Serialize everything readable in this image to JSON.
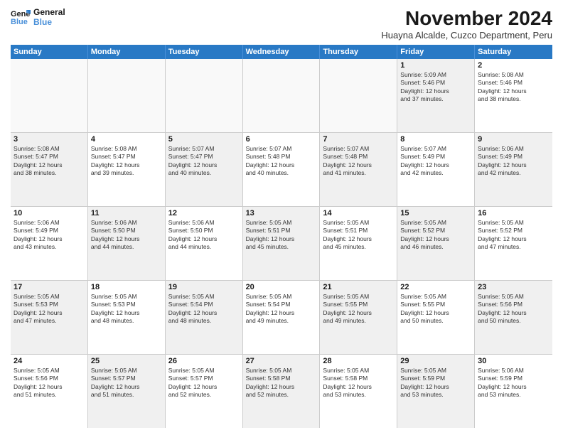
{
  "logo": {
    "line1": "General",
    "line2": "Blue"
  },
  "title": "November 2024",
  "location": "Huayna Alcalde, Cuzco Department, Peru",
  "days_of_week": [
    "Sunday",
    "Monday",
    "Tuesday",
    "Wednesday",
    "Thursday",
    "Friday",
    "Saturday"
  ],
  "weeks": [
    {
      "cells": [
        {
          "day": "",
          "info": "",
          "empty": true
        },
        {
          "day": "",
          "info": "",
          "empty": true
        },
        {
          "day": "",
          "info": "",
          "empty": true
        },
        {
          "day": "",
          "info": "",
          "empty": true
        },
        {
          "day": "",
          "info": "",
          "empty": true
        },
        {
          "day": "1",
          "info": "Sunrise: 5:09 AM\nSunset: 5:46 PM\nDaylight: 12 hours\nand 37 minutes.",
          "shaded": true
        },
        {
          "day": "2",
          "info": "Sunrise: 5:08 AM\nSunset: 5:46 PM\nDaylight: 12 hours\nand 38 minutes.",
          "shaded": false
        }
      ]
    },
    {
      "cells": [
        {
          "day": "3",
          "info": "Sunrise: 5:08 AM\nSunset: 5:47 PM\nDaylight: 12 hours\nand 38 minutes.",
          "shaded": true
        },
        {
          "day": "4",
          "info": "Sunrise: 5:08 AM\nSunset: 5:47 PM\nDaylight: 12 hours\nand 39 minutes.",
          "shaded": false
        },
        {
          "day": "5",
          "info": "Sunrise: 5:07 AM\nSunset: 5:47 PM\nDaylight: 12 hours\nand 40 minutes.",
          "shaded": true
        },
        {
          "day": "6",
          "info": "Sunrise: 5:07 AM\nSunset: 5:48 PM\nDaylight: 12 hours\nand 40 minutes.",
          "shaded": false
        },
        {
          "day": "7",
          "info": "Sunrise: 5:07 AM\nSunset: 5:48 PM\nDaylight: 12 hours\nand 41 minutes.",
          "shaded": true
        },
        {
          "day": "8",
          "info": "Sunrise: 5:07 AM\nSunset: 5:49 PM\nDaylight: 12 hours\nand 42 minutes.",
          "shaded": false
        },
        {
          "day": "9",
          "info": "Sunrise: 5:06 AM\nSunset: 5:49 PM\nDaylight: 12 hours\nand 42 minutes.",
          "shaded": true
        }
      ]
    },
    {
      "cells": [
        {
          "day": "10",
          "info": "Sunrise: 5:06 AM\nSunset: 5:49 PM\nDaylight: 12 hours\nand 43 minutes.",
          "shaded": false
        },
        {
          "day": "11",
          "info": "Sunrise: 5:06 AM\nSunset: 5:50 PM\nDaylight: 12 hours\nand 44 minutes.",
          "shaded": true
        },
        {
          "day": "12",
          "info": "Sunrise: 5:06 AM\nSunset: 5:50 PM\nDaylight: 12 hours\nand 44 minutes.",
          "shaded": false
        },
        {
          "day": "13",
          "info": "Sunrise: 5:05 AM\nSunset: 5:51 PM\nDaylight: 12 hours\nand 45 minutes.",
          "shaded": true
        },
        {
          "day": "14",
          "info": "Sunrise: 5:05 AM\nSunset: 5:51 PM\nDaylight: 12 hours\nand 45 minutes.",
          "shaded": false
        },
        {
          "day": "15",
          "info": "Sunrise: 5:05 AM\nSunset: 5:52 PM\nDaylight: 12 hours\nand 46 minutes.",
          "shaded": true
        },
        {
          "day": "16",
          "info": "Sunrise: 5:05 AM\nSunset: 5:52 PM\nDaylight: 12 hours\nand 47 minutes.",
          "shaded": false
        }
      ]
    },
    {
      "cells": [
        {
          "day": "17",
          "info": "Sunrise: 5:05 AM\nSunset: 5:53 PM\nDaylight: 12 hours\nand 47 minutes.",
          "shaded": true
        },
        {
          "day": "18",
          "info": "Sunrise: 5:05 AM\nSunset: 5:53 PM\nDaylight: 12 hours\nand 48 minutes.",
          "shaded": false
        },
        {
          "day": "19",
          "info": "Sunrise: 5:05 AM\nSunset: 5:54 PM\nDaylight: 12 hours\nand 48 minutes.",
          "shaded": true
        },
        {
          "day": "20",
          "info": "Sunrise: 5:05 AM\nSunset: 5:54 PM\nDaylight: 12 hours\nand 49 minutes.",
          "shaded": false
        },
        {
          "day": "21",
          "info": "Sunrise: 5:05 AM\nSunset: 5:55 PM\nDaylight: 12 hours\nand 49 minutes.",
          "shaded": true
        },
        {
          "day": "22",
          "info": "Sunrise: 5:05 AM\nSunset: 5:55 PM\nDaylight: 12 hours\nand 50 minutes.",
          "shaded": false
        },
        {
          "day": "23",
          "info": "Sunrise: 5:05 AM\nSunset: 5:56 PM\nDaylight: 12 hours\nand 50 minutes.",
          "shaded": true
        }
      ]
    },
    {
      "cells": [
        {
          "day": "24",
          "info": "Sunrise: 5:05 AM\nSunset: 5:56 PM\nDaylight: 12 hours\nand 51 minutes.",
          "shaded": false
        },
        {
          "day": "25",
          "info": "Sunrise: 5:05 AM\nSunset: 5:57 PM\nDaylight: 12 hours\nand 51 minutes.",
          "shaded": true
        },
        {
          "day": "26",
          "info": "Sunrise: 5:05 AM\nSunset: 5:57 PM\nDaylight: 12 hours\nand 52 minutes.",
          "shaded": false
        },
        {
          "day": "27",
          "info": "Sunrise: 5:05 AM\nSunset: 5:58 PM\nDaylight: 12 hours\nand 52 minutes.",
          "shaded": true
        },
        {
          "day": "28",
          "info": "Sunrise: 5:05 AM\nSunset: 5:58 PM\nDaylight: 12 hours\nand 53 minutes.",
          "shaded": false
        },
        {
          "day": "29",
          "info": "Sunrise: 5:05 AM\nSunset: 5:59 PM\nDaylight: 12 hours\nand 53 minutes.",
          "shaded": true
        },
        {
          "day": "30",
          "info": "Sunrise: 5:06 AM\nSunset: 5:59 PM\nDaylight: 12 hours\nand 53 minutes.",
          "shaded": false
        }
      ]
    }
  ]
}
